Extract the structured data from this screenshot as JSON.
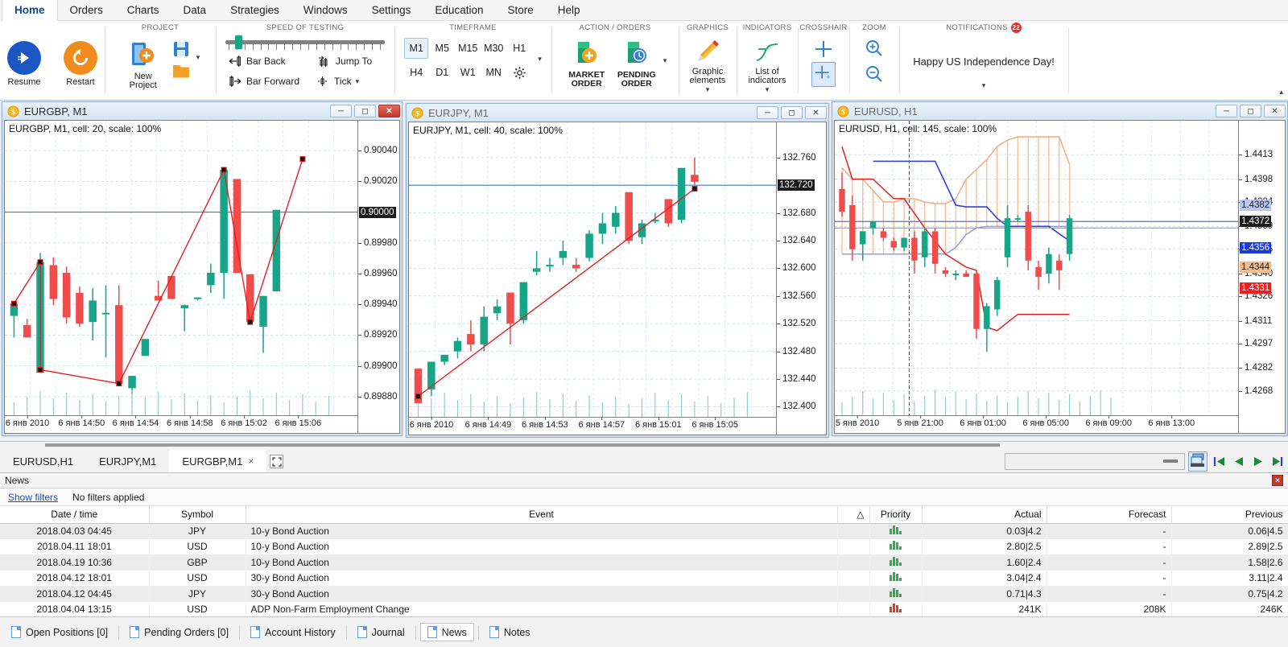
{
  "menu": {
    "items": [
      {
        "label": "Home",
        "active": true
      },
      {
        "label": "Orders",
        "active": false
      },
      {
        "label": "Charts",
        "active": false
      },
      {
        "label": "Data",
        "active": false
      },
      {
        "label": "Strategies",
        "active": false
      },
      {
        "label": "Windows",
        "active": false
      },
      {
        "label": "Settings",
        "active": false
      },
      {
        "label": "Education",
        "active": false
      },
      {
        "label": "Store",
        "active": false
      },
      {
        "label": "Help",
        "active": false
      }
    ]
  },
  "ribbon": {
    "resume": {
      "label": "Resume",
      "icon": "play-circle-icon"
    },
    "restart": {
      "label": "Restart",
      "icon": "restart-circle-icon"
    },
    "project": {
      "title": "PROJECT",
      "new_project": "New\nProject",
      "new_project_line1": "New",
      "new_project_line2": "Project",
      "save_icon": "save-icon",
      "open_icon": "folder-icon",
      "dropdown": "chevron-down-icon"
    },
    "speed": {
      "title": "SPEED OF TESTING",
      "bar_back": "Bar Back",
      "bar_forward": "Bar Forward",
      "jump_to": "Jump To",
      "tick": "Tick",
      "slider_value": 6,
      "slider_ticks": 20
    },
    "timeframe": {
      "title": "TIMEFRAME",
      "row1": [
        "M1",
        "M5",
        "M15",
        "M30",
        "H1"
      ],
      "row2": [
        "H4",
        "D1",
        "W1",
        "MN"
      ],
      "selected": "M1",
      "settings_icon": "gear-icon",
      "expand_icon": "chevron-down-icon"
    },
    "action": {
      "title": "ACTION / ORDERS",
      "market_order_l1": "MARKET",
      "market_order_l2": "ORDER",
      "pending_order_l1": "PENDING",
      "pending_order_l2": "ORDER",
      "dropdown": "chevron-down-icon"
    },
    "graphics": {
      "title": "GRAPHICS",
      "l1": "Graphic",
      "l2": "elements",
      "icon": "pencil-icon",
      "dropdown": "chevron-down-icon"
    },
    "indicators": {
      "title": "INDICATORS",
      "l1": "List of",
      "l2": "indicators",
      "icon": "function-curve-icon",
      "dropdown": "chevron-down-icon"
    },
    "crosshair": {
      "title": "CROSSHAIR",
      "icon1": "crosshair-icon",
      "icon2": "crosshair-measure-icon"
    },
    "zoom": {
      "title": "ZOOM",
      "zoom_in_icon": "zoom-in-icon",
      "zoom_out_icon": "zoom-out-icon"
    },
    "notifications": {
      "title": "NOTIFICATIONS",
      "count": "22",
      "message": "Happy US Independence Day!",
      "dropdown": "chevron-down-icon"
    },
    "collapse_icon": "chevron-up-icon"
  },
  "charts": [
    {
      "title": "EURGBP, M1",
      "plot_label": "EURGBP, M1, cell: 20, scale: 100%",
      "active": true,
      "icon": "symbol-coin-icon",
      "buttons": {
        "minimize": "minimize-icon",
        "maximize": "maximize-icon",
        "close": "close-icon"
      },
      "y_ticks": [
        "0.90040",
        "0.90020",
        "0.89980",
        "0.89960",
        "0.89940",
        "0.89920",
        "0.89900",
        "0.89880"
      ],
      "y_badge": {
        "value": "0.90000",
        "bg": "#1c1c1c",
        "fg": "#ffffff"
      },
      "x_ticks": [
        "6 янв 2010",
        "6 янв 14:50",
        "6 янв 14:54",
        "6 янв 14:58",
        "6 янв 15:02",
        "6 янв 15:06"
      ]
    },
    {
      "title": "EURJPY, M1",
      "plot_label": "EURJPY, M1, cell: 40, scale: 100%",
      "active": false,
      "icon": "symbol-coin-icon",
      "buttons": {
        "minimize": "minimize-icon",
        "maximize": "maximize-icon",
        "close": "close-icon"
      },
      "y_ticks": [
        "132.760",
        "132.680",
        "132.640",
        "132.600",
        "132.560",
        "132.520",
        "132.480",
        "132.440",
        "132.400"
      ],
      "y_badge": {
        "value": "132.720",
        "bg": "#1c1c1c",
        "fg": "#ffffff"
      },
      "x_ticks": [
        "6 янв 2010",
        "6 янв 14:49",
        "6 янв 14:53",
        "6 янв 14:57",
        "6 янв 15:01",
        "6 янв 15:05"
      ]
    },
    {
      "title": "EURUSD, H1",
      "plot_label": "EURUSD, H1, cell: 145, scale: 100%",
      "active": false,
      "icon": "symbol-coin-icon",
      "buttons": {
        "minimize": "minimize-icon",
        "maximize": "maximize-icon",
        "close": "close-icon"
      },
      "y_ticks": [
        "1.4413",
        "1.4398",
        "1.4384",
        "1.4369",
        "1.4355",
        "1.4340",
        "1.4326",
        "1.4311",
        "1.4297",
        "1.4282",
        "1.4268"
      ],
      "y_badges": [
        {
          "value": "1.4382",
          "bg": "#b9c7f0",
          "fg": "#1a1a1a"
        },
        {
          "value": "1.4372",
          "bg": "#1c1c1c",
          "fg": "#ffffff"
        },
        {
          "value": "1.4356",
          "bg": "#1a3ad6",
          "fg": "#ffffff"
        },
        {
          "value": "1.4344",
          "bg": "#f7bc8d",
          "fg": "#1a1a1a"
        },
        {
          "value": "1.4331",
          "bg": "#f01d1d",
          "fg": "#ffffff"
        }
      ],
      "x_ticks": [
        "5 янв 2010",
        "5 янв 21:00",
        "6 янв 01:00",
        "6 янв 05:00",
        "6 янв 09:00",
        "6 янв 13:00"
      ]
    }
  ],
  "chart_tabs": {
    "items": [
      {
        "label": "EURUSD,H1",
        "selected": false,
        "closable": false
      },
      {
        "label": "EURJPY,M1",
        "selected": false,
        "closable": false
      },
      {
        "label": "EURGBP,M1",
        "selected": true,
        "closable": true,
        "close_label": "×"
      }
    ],
    "fullscreen_icon": "fullscreen-icon",
    "speed_slider_value": "",
    "toolbar_icons": [
      "windows-cascade-icon",
      "skip-first-icon",
      "step-back-icon",
      "play-icon",
      "skip-last-icon"
    ]
  },
  "news_panel": {
    "title": "News",
    "close_icon": "close-icon",
    "show_filters": "Show filters",
    "filter_status": "No filters applied",
    "sort_indicator": "△",
    "columns": [
      "Date / time",
      "Symbol",
      "Event",
      "",
      "Priority",
      "Actual",
      "Forecast",
      "Previous"
    ],
    "rows": [
      {
        "datetime": "2018.04.03 04:45",
        "symbol": "JPY",
        "event": "10-y Bond Auction",
        "priority": "low",
        "actual": "0.03|4.2",
        "forecast": "-",
        "previous": "0.06|4.5"
      },
      {
        "datetime": "2018.04.11 18:01",
        "symbol": "USD",
        "event": "10-y Bond Auction",
        "priority": "low",
        "actual": "2.80|2.5",
        "forecast": "-",
        "previous": "2.89|2.5"
      },
      {
        "datetime": "2018.04.19 10:36",
        "symbol": "GBP",
        "event": "10-y Bond Auction",
        "priority": "low",
        "actual": "1.60|2.4",
        "forecast": "-",
        "previous": "1.58|2.6"
      },
      {
        "datetime": "2018.04.12 18:01",
        "symbol": "USD",
        "event": "30-y Bond Auction",
        "priority": "low",
        "actual": "3.04|2.4",
        "forecast": "-",
        "previous": "3.11|2.4"
      },
      {
        "datetime": "2018.04.12 04:45",
        "symbol": "JPY",
        "event": "30-y Bond Auction",
        "priority": "low",
        "actual": "0.71|4.3",
        "forecast": "-",
        "previous": "0.75|4.2"
      },
      {
        "datetime": "2018.04.04 13:15",
        "symbol": "USD",
        "event": "ADP Non-Farm Employment Change",
        "priority": "high",
        "actual": "241K",
        "forecast": "208K",
        "previous": "246K"
      }
    ]
  },
  "bottom_tabs": {
    "items": [
      {
        "label": "Open Positions [0]",
        "icon": "document-icon",
        "selected": false
      },
      {
        "label": "Pending Orders [0]",
        "icon": "document-p-icon",
        "selected": false
      },
      {
        "label": "Account History",
        "icon": "grid-icon",
        "selected": false
      },
      {
        "label": "Journal",
        "icon": "journal-icon",
        "selected": false
      },
      {
        "label": "News",
        "icon": "news-icon",
        "selected": true
      },
      {
        "label": "Notes",
        "icon": "notes-icon",
        "selected": false
      }
    ]
  },
  "colors": {
    "bull": "#17a589",
    "bear": "#ef4c4c",
    "trendline": "#e02020",
    "price_line": "#4a77c8",
    "accent": "#1a4ea8"
  },
  "chart_data": [
    {
      "type": "candlestick",
      "name": "EURGBP M1",
      "title": "EURGBP, M1, cell: 20, scale: 100%",
      "ylim": [
        0.8987,
        0.9005
      ],
      "ylabel": "",
      "xlabel": "",
      "grid": true,
      "price_line": 0.9,
      "candles": [
        {
          "o": 0.899325,
          "h": 0.899325,
          "l": 0.899185,
          "c": 0.899405
        },
        {
          "o": 0.899265,
          "h": 0.899305,
          "l": 0.899185,
          "c": 0.899185
        },
        {
          "o": 0.898955,
          "h": 0.899735,
          "l": 0.898955,
          "c": 0.899675
        },
        {
          "o": 0.899655,
          "h": 0.899705,
          "l": 0.899395,
          "c": 0.899435
        },
        {
          "o": 0.899605,
          "h": 0.899645,
          "l": 0.899275,
          "c": 0.899315
        },
        {
          "o": 0.899475,
          "h": 0.899515,
          "l": 0.899255,
          "c": 0.899275
        },
        {
          "o": 0.899285,
          "h": 0.899505,
          "l": 0.899165,
          "c": 0.899425
        },
        {
          "o": 0.899345,
          "h": 0.899525,
          "l": 0.899055,
          "c": 0.899345
        },
        {
          "o": 0.899395,
          "h": 0.899525,
          "l": 0.898885,
          "c": 0.898885
        },
        {
          "o": 0.898855,
          "h": 0.898935,
          "l": 0.898815,
          "c": 0.898935
        },
        {
          "o": 0.899065,
          "h": 0.899175,
          "l": 0.899065,
          "c": 0.899175
        },
        {
          "o": 0.899455,
          "h": 0.899555,
          "l": 0.899425,
          "c": 0.899425
        },
        {
          "o": 0.899585,
          "h": 0.899585,
          "l": 0.899435,
          "c": 0.899435
        },
        {
          "o": 0.899375,
          "h": 0.899395,
          "l": 0.899225,
          "c": 0.899395
        },
        {
          "o": 0.899445,
          "h": 0.899445,
          "l": 0.899425,
          "c": 0.899445
        },
        {
          "o": 0.899525,
          "h": 0.899665,
          "l": 0.899475,
          "c": 0.899605
        },
        {
          "o": 0.899605,
          "h": 0.900275,
          "l": 0.899435,
          "c": 0.900275
        },
        {
          "o": 0.900215,
          "h": 0.900215,
          "l": 0.899605,
          "c": 0.899605
        },
        {
          "o": 0.899595,
          "h": 0.899595,
          "l": 0.899285,
          "c": 0.899285
        },
        {
          "o": 0.899255,
          "h": 0.899455,
          "l": 0.899085,
          "c": 0.899455
        },
        {
          "o": 0.899485,
          "h": 0.900015,
          "l": 0.899485,
          "c": 0.900015
        }
      ],
      "trendline": [
        {
          "i": 0,
          "v": 0.899405
        },
        {
          "i": 2,
          "v": 0.899675
        },
        {
          "i": 2,
          "v": 0.898975
        },
        {
          "i": 8,
          "v": 0.898885
        },
        {
          "i": 16,
          "v": 0.900275
        },
        {
          "i": 18,
          "v": 0.899285
        },
        {
          "i": 22,
          "v": 0.900345
        }
      ]
    },
    {
      "type": "candlestick",
      "name": "EURJPY M1",
      "title": "EURJPY, M1, cell: 40, scale: 100%",
      "ylim": [
        132.39,
        132.79
      ],
      "price_line": 132.72,
      "grid": true,
      "candles": [
        {
          "o": 132.455,
          "h": 132.455,
          "l": 132.405,
          "c": 132.405
        },
        {
          "o": 132.425,
          "h": 132.465,
          "l": 132.415,
          "c": 132.465
        },
        {
          "o": 132.465,
          "h": 132.475,
          "l": 132.46,
          "c": 132.475
        },
        {
          "o": 132.48,
          "h": 132.5,
          "l": 132.47,
          "c": 132.495
        },
        {
          "o": 132.505,
          "h": 132.525,
          "l": 132.48,
          "c": 132.49
        },
        {
          "o": 132.49,
          "h": 132.545,
          "l": 132.48,
          "c": 132.53
        },
        {
          "o": 132.535,
          "h": 132.555,
          "l": 132.525,
          "c": 132.545
        },
        {
          "o": 132.565,
          "h": 132.565,
          "l": 132.49,
          "c": 132.52
        },
        {
          "o": 132.525,
          "h": 132.58,
          "l": 132.52,
          "c": 132.58
        },
        {
          "o": 132.595,
          "h": 132.625,
          "l": 132.59,
          "c": 132.6
        },
        {
          "o": 132.605,
          "h": 132.615,
          "l": 132.595,
          "c": 132.605
        },
        {
          "o": 132.615,
          "h": 132.64,
          "l": 132.605,
          "c": 132.625
        },
        {
          "o": 132.605,
          "h": 132.615,
          "l": 132.595,
          "c": 132.6
        },
        {
          "o": 132.615,
          "h": 132.655,
          "l": 132.61,
          "c": 132.65
        },
        {
          "o": 132.65,
          "h": 132.68,
          "l": 132.635,
          "c": 132.665
        },
        {
          "o": 132.66,
          "h": 132.69,
          "l": 132.65,
          "c": 132.68
        },
        {
          "o": 132.71,
          "h": 132.71,
          "l": 132.635,
          "c": 132.64
        },
        {
          "o": 132.645,
          "h": 132.67,
          "l": 132.635,
          "c": 132.665
        },
        {
          "o": 132.67,
          "h": 132.68,
          "l": 132.665,
          "c": 132.67
        },
        {
          "o": 132.7,
          "h": 132.7,
          "l": 132.66,
          "c": 132.665
        },
        {
          "o": 132.67,
          "h": 132.745,
          "l": 132.665,
          "c": 132.745
        },
        {
          "o": 132.735,
          "h": 132.76,
          "l": 132.72,
          "c": 132.725
        }
      ],
      "trendline": [
        {
          "i": 0,
          "v": 132.415
        },
        {
          "i": 21,
          "v": 132.715
        }
      ]
    },
    {
      "type": "candlestick",
      "name": "EURUSD H1",
      "title": "EURUSD, H1, cell: 145, scale: 100%",
      "ylim": [
        1.4255,
        1.4425
      ],
      "grid": true,
      "price_line": 1.4372,
      "indicators": [
        {
          "name": "bollinger-upper",
          "color": "#f5a97f"
        },
        {
          "name": "bollinger-lower",
          "color": "#f5a97f"
        },
        {
          "name": "support-resistance-blue",
          "color": "#2b3ee0"
        },
        {
          "name": "parabolic-red",
          "color": "#e02020"
        },
        {
          "name": "channel-light-blue",
          "color": "#8f9fe8"
        }
      ],
      "candles": [
        {
          "o": 1.4392,
          "h": 1.4402,
          "l": 1.4375,
          "c": 1.4378
        },
        {
          "o": 1.4382,
          "h": 1.4388,
          "l": 1.4348,
          "c": 1.4355
        },
        {
          "o": 1.4358,
          "h": 1.4366,
          "l": 1.4348,
          "c": 1.4366
        },
        {
          "o": 1.4368,
          "h": 1.4372,
          "l": 1.4364,
          "c": 1.4372
        },
        {
          "o": 1.4366,
          "h": 1.4368,
          "l": 1.436,
          "c": 1.4362
        },
        {
          "o": 1.436,
          "h": 1.4362,
          "l": 1.4354,
          "c": 1.4356
        },
        {
          "o": 1.4356,
          "h": 1.4362,
          "l": 1.4354,
          "c": 1.4362
        },
        {
          "o": 1.4362,
          "h": 1.4366,
          "l": 1.434,
          "c": 1.4348
        },
        {
          "o": 1.435,
          "h": 1.4368,
          "l": 1.4344,
          "c": 1.4366
        },
        {
          "o": 1.4366,
          "h": 1.4368,
          "l": 1.434,
          "c": 1.4346
        },
        {
          "o": 1.4342,
          "h": 1.4344,
          "l": 1.4338,
          "c": 1.434
        },
        {
          "o": 1.434,
          "h": 1.4342,
          "l": 1.4336,
          "c": 1.434
        },
        {
          "o": 1.434,
          "h": 1.4342,
          "l": 1.4338,
          "c": 1.4338
        },
        {
          "o": 1.434,
          "h": 1.4342,
          "l": 1.43,
          "c": 1.4306
        },
        {
          "o": 1.4306,
          "h": 1.4322,
          "l": 1.4292,
          "c": 1.432
        },
        {
          "o": 1.4318,
          "h": 1.4338,
          "l": 1.4314,
          "c": 1.4336
        },
        {
          "o": 1.435,
          "h": 1.4382,
          "l": 1.4344,
          "c": 1.4374
        },
        {
          "o": 1.4374,
          "h": 1.4376,
          "l": 1.4372,
          "c": 1.4374
        },
        {
          "o": 1.4378,
          "h": 1.4382,
          "l": 1.4342,
          "c": 1.4348
        },
        {
          "o": 1.4344,
          "h": 1.4348,
          "l": 1.433,
          "c": 1.4338
        },
        {
          "o": 1.434,
          "h": 1.4356,
          "l": 1.4334,
          "c": 1.4352
        },
        {
          "o": 1.4348,
          "h": 1.4352,
          "l": 1.433,
          "c": 1.4342
        },
        {
          "o": 1.4352,
          "h": 1.4376,
          "l": 1.4348,
          "c": 1.4374
        }
      ]
    }
  ]
}
